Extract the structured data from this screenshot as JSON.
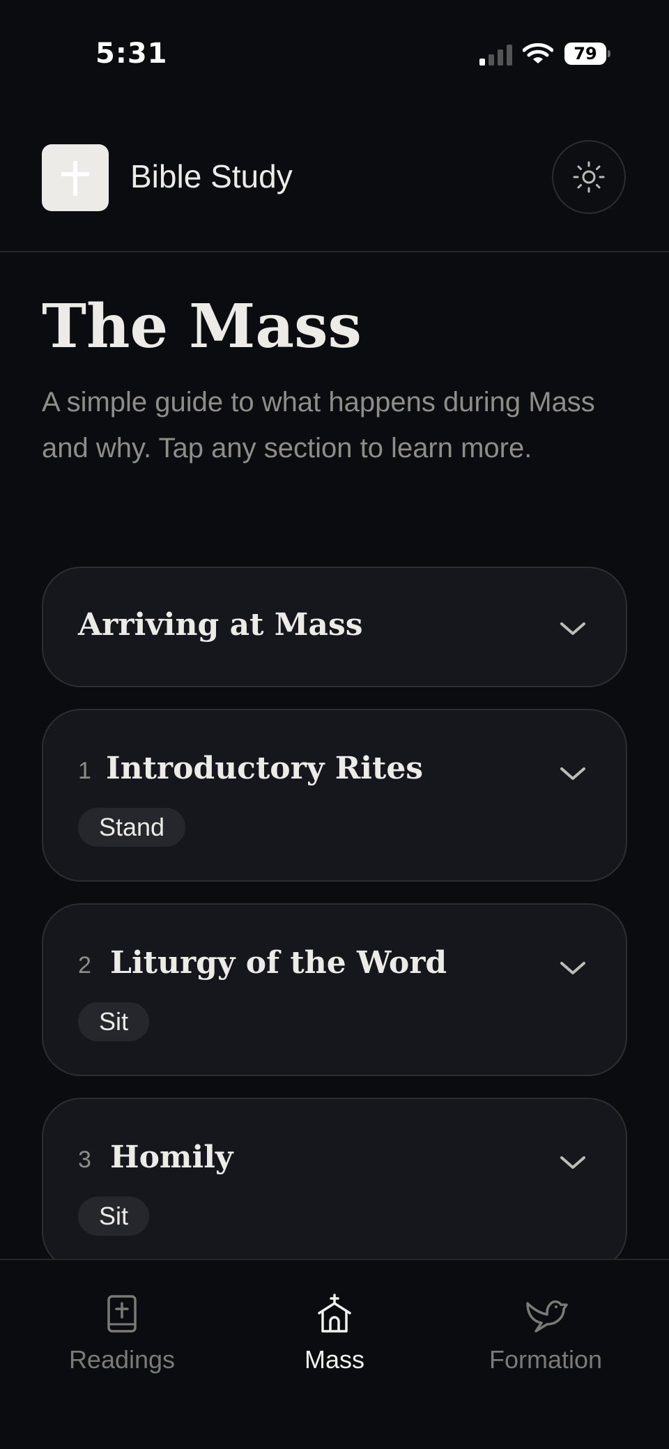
{
  "status_bar": {
    "time": "5:31",
    "battery": "79",
    "icons": [
      "signal-icon",
      "wifi-icon",
      "battery-icon"
    ]
  },
  "header": {
    "app_title": "Bible Study",
    "logo_icon": "cross-icon",
    "theme_toggle_icon": "sun-icon"
  },
  "page": {
    "title": "The Mass",
    "subtitle": "A simple guide to what happens during Mass and why. Tap any section to learn more."
  },
  "sections": [
    {
      "number": "",
      "title": "Arriving at Mass",
      "posture": ""
    },
    {
      "number": "1",
      "title": "Introductory Rites",
      "posture": "Stand"
    },
    {
      "number": "2",
      "title": "Liturgy of the Word",
      "posture": "Sit"
    },
    {
      "number": "3",
      "title": "Homily",
      "posture": "Sit"
    }
  ],
  "nav": {
    "items": [
      {
        "label": "Readings",
        "icon": "book-icon",
        "active": false
      },
      {
        "label": "Mass",
        "icon": "church-icon",
        "active": true
      },
      {
        "label": "Formation",
        "icon": "dove-icon",
        "active": false
      }
    ]
  },
  "colors": {
    "background": "#0b0c10",
    "card": "#15171c",
    "text": "#ecebe8",
    "muted": "#8e8d8a"
  }
}
